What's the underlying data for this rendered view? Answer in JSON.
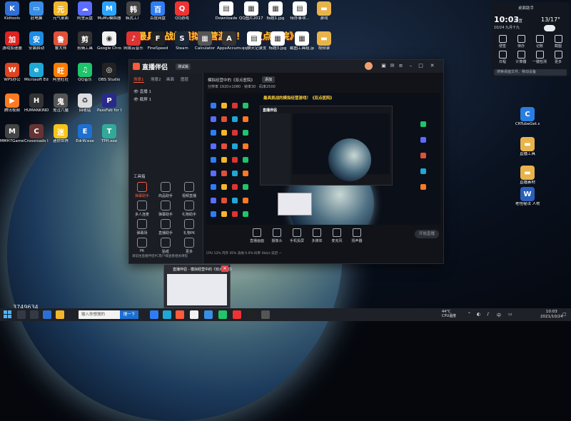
{
  "headline": "最具挑战的模拟经营游戏！《双点医院》",
  "channel_id": "3749634",
  "desktop_icons": [
    {
      "label": "Kidtools",
      "color": "#2f6fd6",
      "glyph": "K"
    },
    {
      "label": "此电脑",
      "color": "#3a8ee6",
      "glyph": "▭"
    },
    {
      "label": "元气桌面",
      "color": "#f2b62b",
      "glyph": "元"
    },
    {
      "label": "阿里云盘",
      "color": "#5b6cff",
      "glyph": "☁"
    },
    {
      "label": "MuMu模拟器",
      "color": "#2ba4ff",
      "glyph": "M"
    },
    {
      "label": "韩式工厂",
      "color": "#444",
      "glyph": "韩"
    },
    {
      "label": "百度网盘",
      "color": "#2e7df6",
      "glyph": "百"
    },
    {
      "label": "QQ游戏",
      "color": "#e33",
      "glyph": "Q"
    },
    {
      "label": "Downloade",
      "color": "#ffffff",
      "glyph": "▤"
    },
    {
      "label": "QQ图片2017122...",
      "color": "#fff",
      "glyph": "▦"
    },
    {
      "label": "标题1.jpg",
      "color": "#fff",
      "glyph": "▦"
    },
    {
      "label": "待办事项...",
      "color": "#fff",
      "glyph": "▤"
    },
    {
      "label": "游戏",
      "color": "#e8b34a",
      "glyph": "▬"
    },
    {
      "label": "游戏加速器",
      "color": "#d22",
      "glyph": "加"
    },
    {
      "label": "安装启动",
      "color": "#1e8be0",
      "glyph": "安"
    },
    {
      "label": "鲁大师",
      "color": "#e0513a",
      "glyph": "鲁"
    },
    {
      "label": "剪辑工具",
      "color": "#333",
      "glyph": "剪"
    },
    {
      "label": "Google Chrome",
      "color": "#f1f1f1",
      "glyph": "◉"
    },
    {
      "label": "网易云音乐",
      "color": "#d33",
      "glyph": "♪"
    },
    {
      "label": "FineSpeed",
      "color": "#222",
      "glyph": "F"
    },
    {
      "label": "Steam",
      "color": "#1b2838",
      "glyph": "S"
    },
    {
      "label": "Calculator",
      "color": "#555",
      "glyph": "▦"
    },
    {
      "label": "AppxAccumulatorUI...",
      "color": "#333",
      "glyph": "A"
    },
    {
      "label": "qq聊天记录支付宝提...",
      "color": "#fff",
      "glyph": "▤"
    },
    {
      "label": "标题3.jpg",
      "color": "#fff",
      "glyph": "▦"
    },
    {
      "label": "截图工具组.jpg",
      "color": "#fff",
      "glyph": "▦"
    },
    {
      "label": "视频录",
      "color": "#e8b34a",
      "glyph": "▬"
    },
    {
      "label": "WPS办公",
      "color": "#d42",
      "glyph": "W"
    },
    {
      "label": "Microsoft Edge",
      "color": "#1fa7d6",
      "glyph": "e"
    },
    {
      "label": "阿里旺旺",
      "color": "#ff7a00",
      "glyph": "旺"
    },
    {
      "label": "QQ音乐",
      "color": "#1fc46b",
      "glyph": "♫"
    },
    {
      "label": "OBS Studio",
      "color": "#222",
      "glyph": "◎"
    },
    {
      "label": "腾讯视频",
      "color": "#ff7a22",
      "glyph": "▶"
    },
    {
      "label": "HUMANKIND",
      "color": "#333",
      "glyph": "H"
    },
    {
      "label": "鬼泣六魔",
      "color": "#555",
      "glyph": "鬼"
    },
    {
      "label": "回收站",
      "color": "#ddd",
      "glyph": "♻"
    },
    {
      "label": "PassFab for RAR",
      "color": "#2a2a8a",
      "glyph": "P"
    },
    {
      "label": "MMH7GameWindows",
      "color": "#444",
      "glyph": "M"
    },
    {
      "label": "Crossroads Inn Anniv...",
      "color": "#633",
      "glyph": "C"
    },
    {
      "label": "迷你世界",
      "color": "#f7c41a",
      "glyph": "迷"
    },
    {
      "label": "EdrW.exe",
      "color": "#1e6fd1",
      "glyph": "E"
    },
    {
      "label": "TPH.exe",
      "color": "#3a9",
      "glyph": "T"
    }
  ],
  "right_icons": [
    {
      "label": "CRTubeGet.exe",
      "color": "#2a7de1",
      "glyph": "C"
    },
    {
      "label": "直播工具",
      "color": "#e8b34a",
      "glyph": "▬"
    },
    {
      "label": "直播素材",
      "color": "#e8b34a",
      "glyph": "▬"
    },
    {
      "label": "老怪秘法 人物展示.doc",
      "color": "#2b5fb8",
      "glyph": "W"
    }
  ],
  "widget": {
    "title": "桌面助手",
    "time": "10:03",
    "date": "10/24 九月十九",
    "settings": "设置",
    "temp": "13/17°",
    "buttons": [
      "便签",
      "待办",
      "记账",
      "截图",
      "日程",
      "计算器",
      "一键检测",
      "更多"
    ],
    "search_placeholder": "搜索桌面文件、移动设备"
  },
  "app": {
    "name": "直播伴侣",
    "version": "测试版",
    "left_tabs": [
      "场景1",
      "场景2",
      "画面",
      "图层"
    ],
    "left_rows": [
      "直播 1",
      "截屏 1"
    ],
    "tools_title": "工具箱",
    "tools": [
      "弹幕助手",
      "商品助手",
      "视频直播",
      "多人连麦",
      "弹幕助手",
      "礼物助手",
      "弹幕场",
      "直播助手",
      "礼物PK",
      "PK",
      "贴纸",
      "更多"
    ],
    "left_notice": "请前往直播伴侣PC客户端查看相关课程",
    "scene_tab": "模拟经营中的《双点医院》",
    "scene_btn": "添加",
    "subbar": "分辨率 1920×1080 · 帧率30 · 码率2500",
    "preview_headline": "最具挑战的模拟经营游戏！《双点医院》",
    "toolbar": [
      "直播画面",
      "摄像头",
      "手机投屏",
      "多媒体",
      "麦克风",
      "扬声器"
    ],
    "start_live": "开始直播",
    "status": "CPU 12%   内存 45%   丢帧 0.0%   码率 0kb/s   延迟 —"
  },
  "popup_title": "直播伴侣 - 模拟经营中的《双点医院》",
  "taskbar": {
    "search_placeholder": "输入你想搜的",
    "search_button": "搜一下",
    "tray_temp": "44°C\nCPU温度",
    "time": "10:03",
    "date": "2021/10/24"
  }
}
